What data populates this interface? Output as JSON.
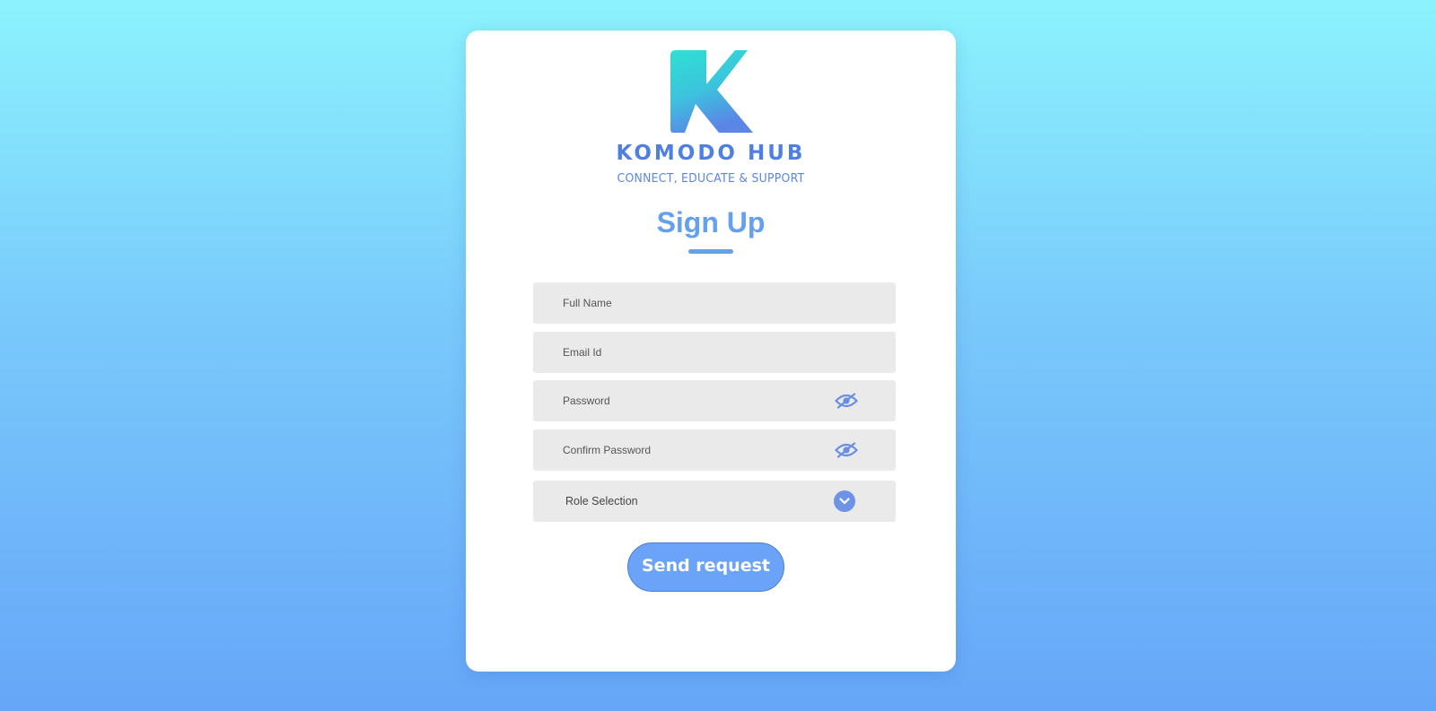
{
  "brand": {
    "name": "KOMODO HUB",
    "tagline": "CONNECT, EDUCATE & SUPPORT"
  },
  "form": {
    "title": "Sign Up",
    "full_name_placeholder": "Full Name",
    "email_placeholder": "Email Id",
    "password_placeholder": "Password",
    "confirm_password_placeholder": "Confirm Password",
    "role_selection_label": "Role Selection",
    "submit_label": "Send request"
  },
  "icons": {
    "logo": "komodo-k-logo",
    "password_toggle": "eye-slash-icon",
    "confirm_password_toggle": "eye-slash-icon",
    "role_dropdown": "chevron-down-icon"
  },
  "colors": {
    "accent": "#64a0ee",
    "brand": "#4f7fe0",
    "button": "#6aa3f7",
    "field_background": "#eaeaea",
    "background_top": "#8cf3fd",
    "background_bottom": "#66a6f8"
  }
}
